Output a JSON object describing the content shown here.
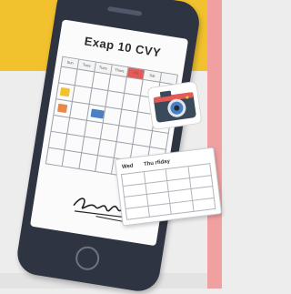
{
  "calendar": {
    "title": "Exap  10 CVY",
    "day_headers": [
      "Sun",
      "Tues",
      "Tues",
      "Thurs",
      "Fri",
      "Sat",
      ""
    ],
    "highlight_colors": {
      "header_red": "#e45a55",
      "yellow": "#f2c12e",
      "orange": "#e8884a",
      "blue": "#4a7fc4"
    }
  },
  "table_card": {
    "headers": [
      "Wed",
      "Thu rfiday"
    ]
  },
  "colors": {
    "background_yellow": "#f2c12e",
    "background_pink": "#f0a0a0",
    "phone_body": "#2e3441"
  },
  "icons": {
    "camera": "camera-icon",
    "signature": "signature-icon"
  }
}
